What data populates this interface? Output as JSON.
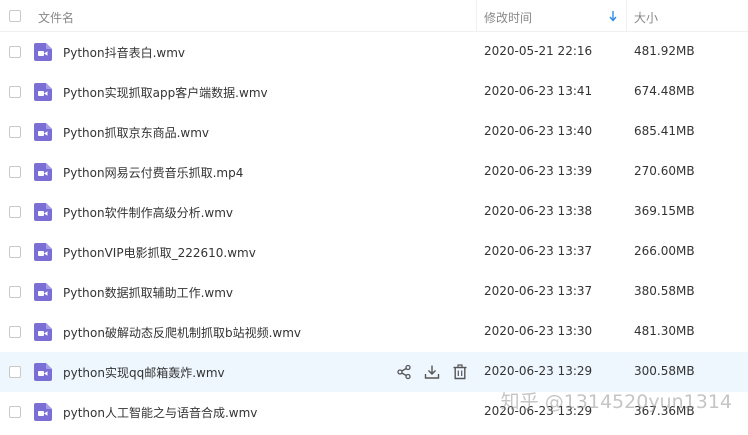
{
  "header": {
    "name_label": "文件名",
    "date_label": "修改时间",
    "size_label": "大小"
  },
  "files": [
    {
      "name": "Python抖音表白.wmv",
      "date": "2020-05-21 22:16",
      "size": "481.92MB"
    },
    {
      "name": "Python实现抓取app客户端数据.wmv",
      "date": "2020-06-23 13:41",
      "size": "674.48MB"
    },
    {
      "name": "Python抓取京东商品.wmv",
      "date": "2020-06-23 13:40",
      "size": "685.41MB"
    },
    {
      "name": "Python网易云付费音乐抓取.mp4",
      "date": "2020-06-23 13:39",
      "size": "270.60MB"
    },
    {
      "name": "Python软件制作高级分析.wmv",
      "date": "2020-06-23 13:38",
      "size": "369.15MB"
    },
    {
      "name": "PythonVIP电影抓取_222610.wmv",
      "date": "2020-06-23 13:37",
      "size": "266.00MB"
    },
    {
      "name": "Python数据抓取辅助工作.wmv",
      "date": "2020-06-23 13:37",
      "size": "380.58MB"
    },
    {
      "name": "python破解动态反爬机制抓取b站视频.wmv",
      "date": "2020-06-23 13:30",
      "size": "481.30MB"
    },
    {
      "name": "python实现qq邮箱轰炸.wmv",
      "date": "2020-06-23 13:29",
      "size": "300.58MB"
    },
    {
      "name": "python人工智能之与语音合成.wmv",
      "date": "2020-06-23 13:29",
      "size": "367.36MB"
    }
  ],
  "watermark": "知乎 @1314520yun1314",
  "icons": {
    "file": "video-file-icon",
    "sort": "sort-arrow-icon",
    "share": "share-icon",
    "download": "download-icon",
    "delete": "trash-icon"
  },
  "colors": {
    "file_icon": "#7b6fd6",
    "hover_row": "#eef6fe",
    "sort_arrow": "#2e8ee6"
  },
  "hovered_row_index": 8
}
